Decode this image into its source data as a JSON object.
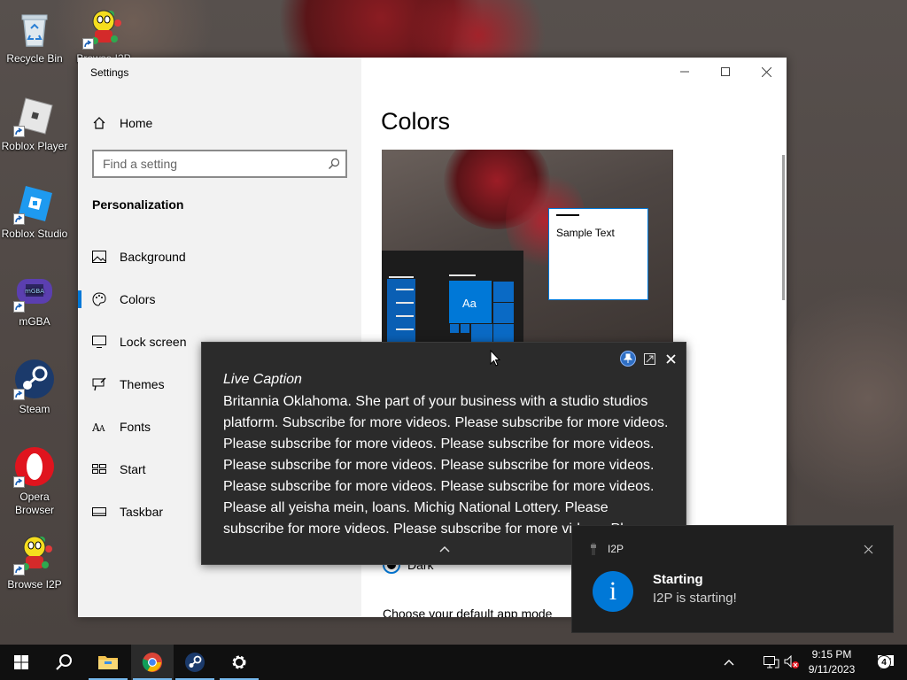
{
  "desktop": {
    "icons": [
      {
        "label": "Recycle Bin",
        "icon": "recycle-bin-icon"
      },
      {
        "label": "Browse I2P",
        "icon": "i2p-icon"
      },
      {
        "label": "Roblox Player",
        "icon": "roblox-player-icon"
      },
      {
        "label": "Roblox Studio",
        "icon": "roblox-studio-icon"
      },
      {
        "label": "mGBA",
        "icon": "mgba-icon"
      },
      {
        "label": "Steam",
        "icon": "steam-icon"
      },
      {
        "label": "Opera Browser",
        "icon": "opera-icon"
      },
      {
        "label": "Browse I2P",
        "icon": "i2p-icon"
      }
    ]
  },
  "settings": {
    "window_title": "Settings",
    "home_label": "Home",
    "search_placeholder": "Find a setting",
    "section_title": "Personalization",
    "nav": [
      {
        "label": "Background",
        "icon": "image-icon"
      },
      {
        "label": "Colors",
        "icon": "palette-icon",
        "active": true
      },
      {
        "label": "Lock screen",
        "icon": "monitor-icon"
      },
      {
        "label": "Themes",
        "icon": "brush-icon"
      },
      {
        "label": "Fonts",
        "icon": "font-icon"
      },
      {
        "label": "Start",
        "icon": "start-grid-icon"
      },
      {
        "label": "Taskbar",
        "icon": "taskbar-icon"
      }
    ],
    "page_title": "Colors",
    "preview": {
      "tile_text": "Aa",
      "sample_text": "Sample Text"
    },
    "radio_dark_label": "Dark",
    "app_mode_label": "Choose your default app mode",
    "accent_color": "#0078d7"
  },
  "live_caption": {
    "header": "Live Caption",
    "text": "Britannia Oklahoma. She part of your business with a studio studios platform. Subscribe for more videos. Please subscribe for more videos. Please subscribe for more videos. Please subscribe for more videos. Please subscribe for more videos. Please subscribe for more videos. Please subscribe for more videos. Please subscribe for more videos. Please all yeisha mein, loans. Michig National Lottery. Please subscribe for more videos. Please subscribe for more videos. Please subscribe for more videos."
  },
  "toast": {
    "app_name": "I2P",
    "title": "Starting",
    "message": "I2P is starting!"
  },
  "taskbar": {
    "apps": [
      "start-icon",
      "search-icon",
      "file-explorer-icon",
      "chrome-icon",
      "steam-icon",
      "settings-gear-icon"
    ],
    "time": "9:15 PM",
    "date": "9/11/2023",
    "notification_count": "4"
  }
}
